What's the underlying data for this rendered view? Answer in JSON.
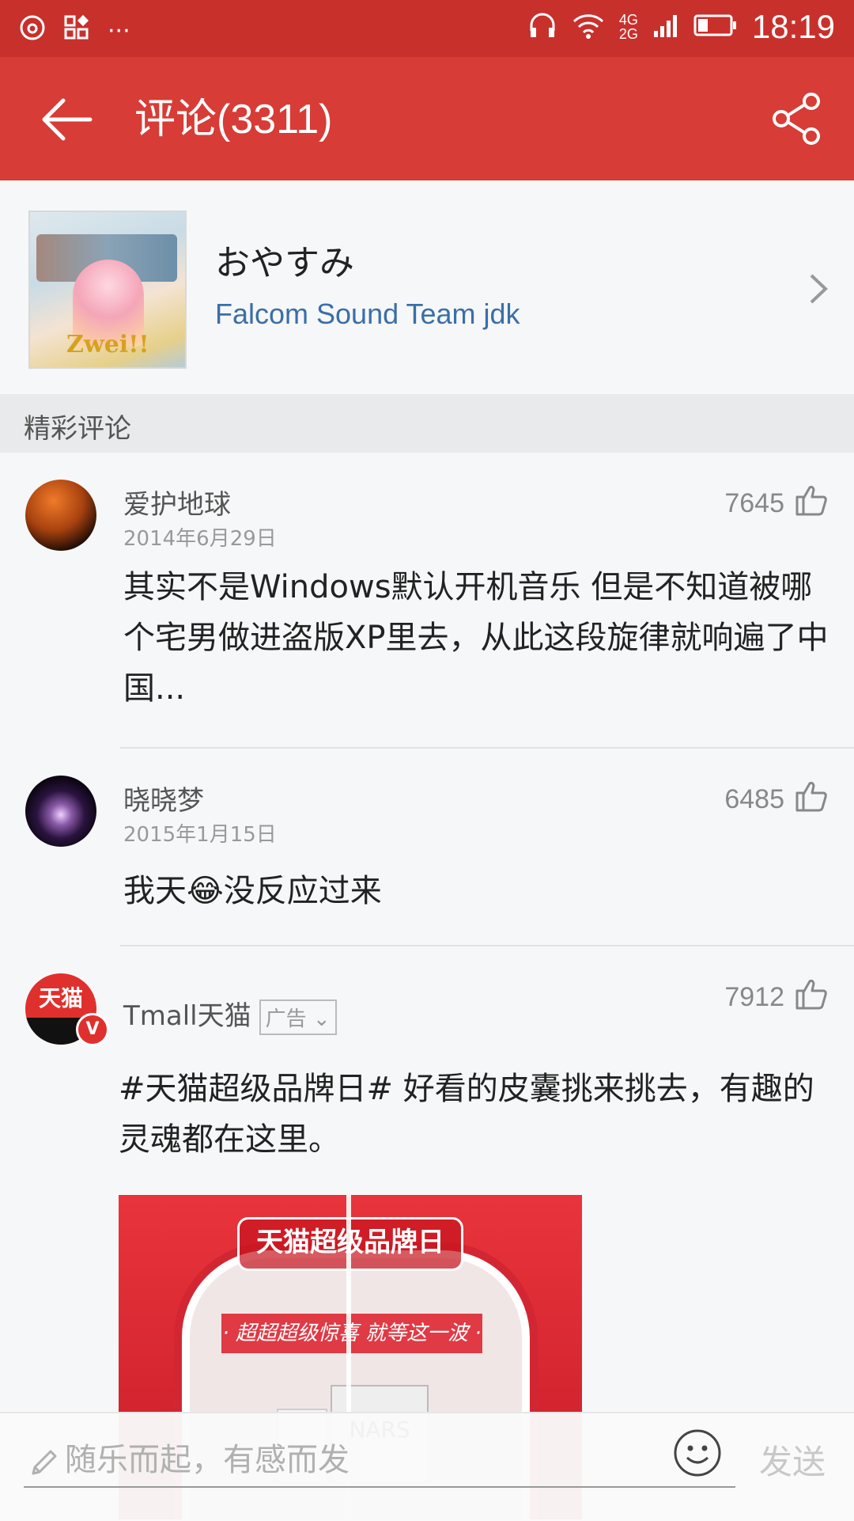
{
  "status_bar": {
    "left_icons": [
      "netease-music-icon",
      "grid-icon",
      "more-dots-icon"
    ],
    "more_text": "···",
    "network_4g": "4G",
    "network_2g": "2G",
    "time": "18:19"
  },
  "app_bar": {
    "title": "评论(3311)",
    "back_icon": "back-arrow-icon",
    "share_icon": "share-icon"
  },
  "song": {
    "title": "おやすみ",
    "artist": "Falcom Sound Team jdk",
    "cover_logo_text": "Zwei!!"
  },
  "section": {
    "label": "精彩评论"
  },
  "comments": [
    {
      "username": "爱护地球",
      "date": "2014年6月29日",
      "likes": "7645",
      "text": "其实不是Windows默认开机音乐 但是不知道被哪个宅男做进盗版XP里去，从此这段旋律就响遍了中国..."
    },
    {
      "username": "晓晓梦",
      "date": "2015年1月15日",
      "likes": "6485",
      "text": "我天😂没反应过来"
    },
    {
      "username": "Tmall天猫",
      "ad_tag": "广告",
      "likes": "7912",
      "text": " #天猫超级品牌日# 好看的皮囊挑来挑去，有趣的灵魂都在这里。",
      "avatar_text": "天猫",
      "verified_badge": "V",
      "ad_image": {
        "sign_text": "天猫超级品牌日",
        "slogan": "· 超超超级惊喜 就等这一波 ·",
        "product_text": "NARS"
      }
    }
  ],
  "bottom_bar": {
    "input_placeholder": "随乐而起，有感而发",
    "send_label": "发送"
  },
  "colors": {
    "status_bar": "#c8302c",
    "app_bar": "#d73c36",
    "artist_link": "#3a6fa6"
  }
}
